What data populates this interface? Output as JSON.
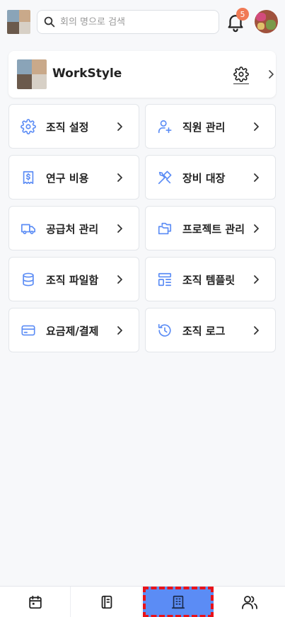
{
  "header": {
    "search_placeholder": "회의 명으로 검색",
    "notification_count": "5"
  },
  "org": {
    "name": "WorkStyle"
  },
  "menu": {
    "items": [
      {
        "label": "조직 설정",
        "icon": "gear-icon"
      },
      {
        "label": "직원 관리",
        "icon": "user-add-icon"
      },
      {
        "label": "연구 비용",
        "icon": "receipt-dollar-icon"
      },
      {
        "label": "장비 대장",
        "icon": "tools-icon"
      },
      {
        "label": "공급처 관리",
        "icon": "truck-icon"
      },
      {
        "label": "프로젝트 관리",
        "icon": "folders-icon"
      },
      {
        "label": "조직 파일함",
        "icon": "database-icon"
      },
      {
        "label": "조직 템플릿",
        "icon": "template-icon"
      },
      {
        "label": "요금제/결제",
        "icon": "credit-card-icon"
      },
      {
        "label": "조직 로그",
        "icon": "history-icon"
      }
    ]
  },
  "bottom_nav": {
    "items": [
      "calendar-icon",
      "notebook-icon",
      "building-icon",
      "users-icon"
    ],
    "active": "building-icon"
  },
  "colors": {
    "accent": "#5b8cf5",
    "badge": "#f07a55",
    "highlight": "#e8121a"
  }
}
